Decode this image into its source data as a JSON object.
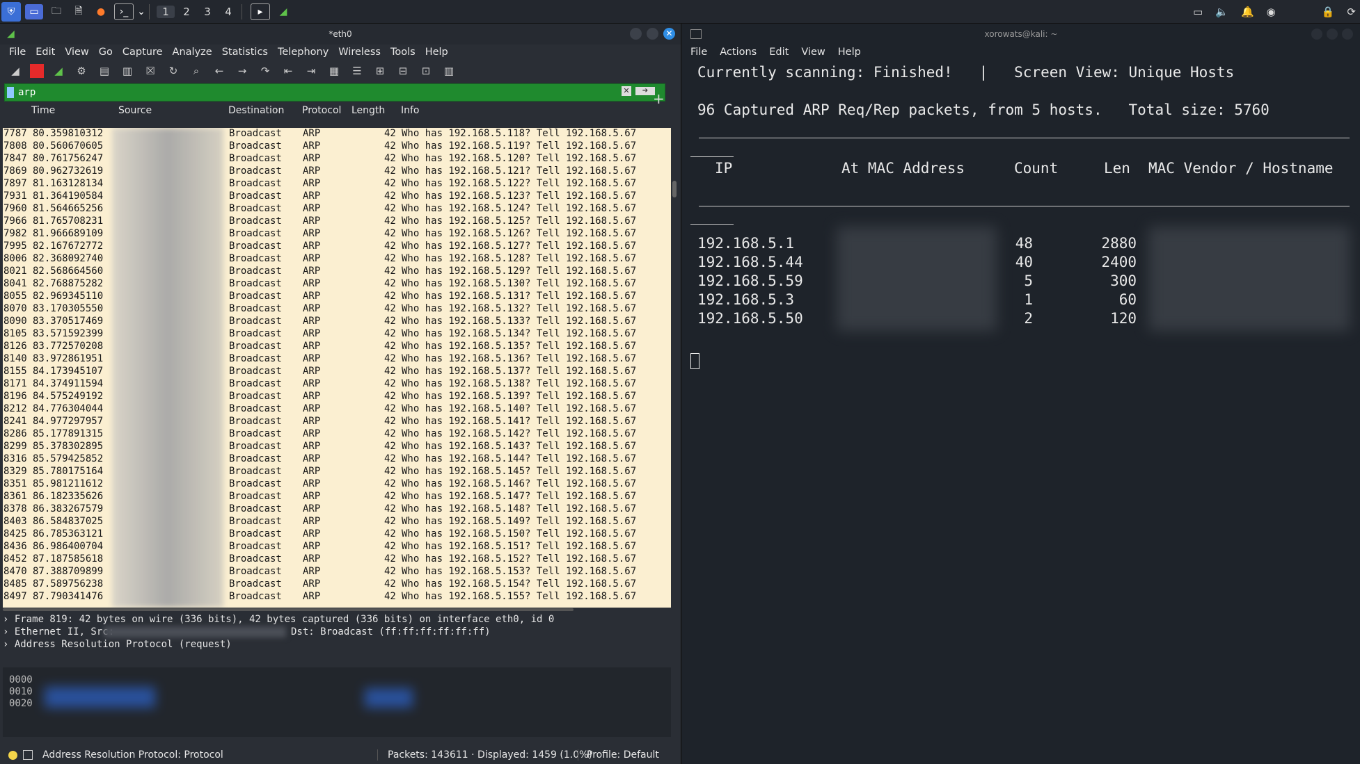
{
  "taskbar": {
    "workspaces": [
      "1",
      "2",
      "3",
      "4"
    ]
  },
  "wireshark": {
    "title": "*eth0",
    "menu": [
      "File",
      "Edit",
      "View",
      "Go",
      "Capture",
      "Analyze",
      "Statistics",
      "Telephony",
      "Wireless",
      "Tools",
      "Help"
    ],
    "filter_value": "arp",
    "columns": [
      "Time",
      "Source",
      "Destination",
      "Protocol",
      "Length",
      "Info"
    ],
    "packets": [
      {
        "no": "7787",
        "time": "80.359810312",
        "dst": "Broadcast",
        "proto": "ARP",
        "len": "42",
        "info": "Who has 192.168.5.118? Tell 192.168.5.67"
      },
      {
        "no": "7808",
        "time": "80.560670605",
        "dst": "Broadcast",
        "proto": "ARP",
        "len": "42",
        "info": "Who has 192.168.5.119? Tell 192.168.5.67"
      },
      {
        "no": "7847",
        "time": "80.761756247",
        "dst": "Broadcast",
        "proto": "ARP",
        "len": "42",
        "info": "Who has 192.168.5.120? Tell 192.168.5.67"
      },
      {
        "no": "7869",
        "time": "80.962732619",
        "dst": "Broadcast",
        "proto": "ARP",
        "len": "42",
        "info": "Who has 192.168.5.121? Tell 192.168.5.67"
      },
      {
        "no": "7897",
        "time": "81.163128134",
        "dst": "Broadcast",
        "proto": "ARP",
        "len": "42",
        "info": "Who has 192.168.5.122? Tell 192.168.5.67"
      },
      {
        "no": "7931",
        "time": "81.364190584",
        "dst": "Broadcast",
        "proto": "ARP",
        "len": "42",
        "info": "Who has 192.168.5.123? Tell 192.168.5.67"
      },
      {
        "no": "7960",
        "time": "81.564665256",
        "dst": "Broadcast",
        "proto": "ARP",
        "len": "42",
        "info": "Who has 192.168.5.124? Tell 192.168.5.67"
      },
      {
        "no": "7966",
        "time": "81.765708231",
        "dst": "Broadcast",
        "proto": "ARP",
        "len": "42",
        "info": "Who has 192.168.5.125? Tell 192.168.5.67"
      },
      {
        "no": "7982",
        "time": "81.966689109",
        "dst": "Broadcast",
        "proto": "ARP",
        "len": "42",
        "info": "Who has 192.168.5.126? Tell 192.168.5.67"
      },
      {
        "no": "7995",
        "time": "82.167672772",
        "dst": "Broadcast",
        "proto": "ARP",
        "len": "42",
        "info": "Who has 192.168.5.127? Tell 192.168.5.67"
      },
      {
        "no": "8006",
        "time": "82.368092740",
        "dst": "Broadcast",
        "proto": "ARP",
        "len": "42",
        "info": "Who has 192.168.5.128? Tell 192.168.5.67"
      },
      {
        "no": "8021",
        "time": "82.568664560",
        "dst": "Broadcast",
        "proto": "ARP",
        "len": "42",
        "info": "Who has 192.168.5.129? Tell 192.168.5.67"
      },
      {
        "no": "8041",
        "time": "82.768875282",
        "dst": "Broadcast",
        "proto": "ARP",
        "len": "42",
        "info": "Who has 192.168.5.130? Tell 192.168.5.67"
      },
      {
        "no": "8055",
        "time": "82.969345110",
        "dst": "Broadcast",
        "proto": "ARP",
        "len": "42",
        "info": "Who has 192.168.5.131? Tell 192.168.5.67"
      },
      {
        "no": "8070",
        "time": "83.170305550",
        "dst": "Broadcast",
        "proto": "ARP",
        "len": "42",
        "info": "Who has 192.168.5.132? Tell 192.168.5.67"
      },
      {
        "no": "8090",
        "time": "83.370517469",
        "dst": "Broadcast",
        "proto": "ARP",
        "len": "42",
        "info": "Who has 192.168.5.133? Tell 192.168.5.67"
      },
      {
        "no": "8105",
        "time": "83.571592399",
        "dst": "Broadcast",
        "proto": "ARP",
        "len": "42",
        "info": "Who has 192.168.5.134? Tell 192.168.5.67"
      },
      {
        "no": "8126",
        "time": "83.772570208",
        "dst": "Broadcast",
        "proto": "ARP",
        "len": "42",
        "info": "Who has 192.168.5.135? Tell 192.168.5.67"
      },
      {
        "no": "8140",
        "time": "83.972861951",
        "dst": "Broadcast",
        "proto": "ARP",
        "len": "42",
        "info": "Who has 192.168.5.136? Tell 192.168.5.67"
      },
      {
        "no": "8155",
        "time": "84.173945107",
        "dst": "Broadcast",
        "proto": "ARP",
        "len": "42",
        "info": "Who has 192.168.5.137? Tell 192.168.5.67"
      },
      {
        "no": "8171",
        "time": "84.374911594",
        "dst": "Broadcast",
        "proto": "ARP",
        "len": "42",
        "info": "Who has 192.168.5.138? Tell 192.168.5.67"
      },
      {
        "no": "8196",
        "time": "84.575249192",
        "dst": "Broadcast",
        "proto": "ARP",
        "len": "42",
        "info": "Who has 192.168.5.139? Tell 192.168.5.67"
      },
      {
        "no": "8212",
        "time": "84.776304044",
        "dst": "Broadcast",
        "proto": "ARP",
        "len": "42",
        "info": "Who has 192.168.5.140? Tell 192.168.5.67"
      },
      {
        "no": "8241",
        "time": "84.977297957",
        "dst": "Broadcast",
        "proto": "ARP",
        "len": "42",
        "info": "Who has 192.168.5.141? Tell 192.168.5.67"
      },
      {
        "no": "8286",
        "time": "85.177891315",
        "dst": "Broadcast",
        "proto": "ARP",
        "len": "42",
        "info": "Who has 192.168.5.142? Tell 192.168.5.67"
      },
      {
        "no": "8299",
        "time": "85.378302895",
        "dst": "Broadcast",
        "proto": "ARP",
        "len": "42",
        "info": "Who has 192.168.5.143? Tell 192.168.5.67"
      },
      {
        "no": "8316",
        "time": "85.579425852",
        "dst": "Broadcast",
        "proto": "ARP",
        "len": "42",
        "info": "Who has 192.168.5.144? Tell 192.168.5.67"
      },
      {
        "no": "8329",
        "time": "85.780175164",
        "dst": "Broadcast",
        "proto": "ARP",
        "len": "42",
        "info": "Who has 192.168.5.145? Tell 192.168.5.67"
      },
      {
        "no": "8351",
        "time": "85.981211612",
        "dst": "Broadcast",
        "proto": "ARP",
        "len": "42",
        "info": "Who has 192.168.5.146? Tell 192.168.5.67"
      },
      {
        "no": "8361",
        "time": "86.182335626",
        "dst": "Broadcast",
        "proto": "ARP",
        "len": "42",
        "info": "Who has 192.168.5.147? Tell 192.168.5.67"
      },
      {
        "no": "8378",
        "time": "86.383267579",
        "dst": "Broadcast",
        "proto": "ARP",
        "len": "42",
        "info": "Who has 192.168.5.148? Tell 192.168.5.67"
      },
      {
        "no": "8403",
        "time": "86.584837025",
        "dst": "Broadcast",
        "proto": "ARP",
        "len": "42",
        "info": "Who has 192.168.5.149? Tell 192.168.5.67"
      },
      {
        "no": "8425",
        "time": "86.785363121",
        "dst": "Broadcast",
        "proto": "ARP",
        "len": "42",
        "info": "Who has 192.168.5.150? Tell 192.168.5.67"
      },
      {
        "no": "8436",
        "time": "86.986400704",
        "dst": "Broadcast",
        "proto": "ARP",
        "len": "42",
        "info": "Who has 192.168.5.151? Tell 192.168.5.67"
      },
      {
        "no": "8452",
        "time": "87.187585618",
        "dst": "Broadcast",
        "proto": "ARP",
        "len": "42",
        "info": "Who has 192.168.5.152? Tell 192.168.5.67"
      },
      {
        "no": "8470",
        "time": "87.388709899",
        "dst": "Broadcast",
        "proto": "ARP",
        "len": "42",
        "info": "Who has 192.168.5.153? Tell 192.168.5.67"
      },
      {
        "no": "8485",
        "time": "87.589756238",
        "dst": "Broadcast",
        "proto": "ARP",
        "len": "42",
        "info": "Who has 192.168.5.154? Tell 192.168.5.67"
      },
      {
        "no": "8497",
        "time": "87.790341476",
        "dst": "Broadcast",
        "proto": "ARP",
        "len": "42",
        "info": "Who has 192.168.5.155? Tell 192.168.5.67"
      }
    ],
    "details": {
      "frame": "Frame 819: 42 bytes on wire (336 bits), 42 bytes captured (336 bits) on interface eth0, id 0",
      "ethernet_prefix": "Ethernet II, Src:",
      "ethernet_dst": "Dst: Broadcast (ff:ff:ff:ff:ff:ff)",
      "arp": "Address Resolution Protocol (request)"
    },
    "bytes_offsets": [
      "0000",
      "0010",
      "0020"
    ],
    "status": {
      "field": "Address Resolution Protocol: Protocol",
      "packets": "Packets: 143611 · Displayed: 1459 (1.0%)",
      "profile": "Profile: Default"
    }
  },
  "terminal": {
    "title": "xorowats@kali: ~",
    "menu": [
      "File",
      "Actions",
      "Edit",
      "View",
      "Help"
    ],
    "scan_line": "Currently scanning: Finished!   |   Screen View: Unique Hosts",
    "summary_line": "96 Captured ARP Req/Rep packets, from 5 hosts.   Total size: 5760",
    "headers": {
      "ip": "IP",
      "mac": "At MAC Address",
      "count": "Count",
      "len": "Len",
      "vendor": "MAC Vendor / Hostname"
    },
    "hosts": [
      {
        "ip": "192.168.5.1",
        "count": "48",
        "len": "2880"
      },
      {
        "ip": "192.168.5.44",
        "count": "40",
        "len": "2400"
      },
      {
        "ip": "192.168.5.59",
        "count": "5",
        "len": "300"
      },
      {
        "ip": "192.168.5.3",
        "count": "1",
        "len": "60"
      },
      {
        "ip": "192.168.5.50",
        "count": "2",
        "len": "120"
      }
    ]
  },
  "colors": {
    "packet_row_bg": "#fbefd1",
    "filter_bg": "#1f8a2e",
    "terminal_bg": "#1e232a"
  }
}
